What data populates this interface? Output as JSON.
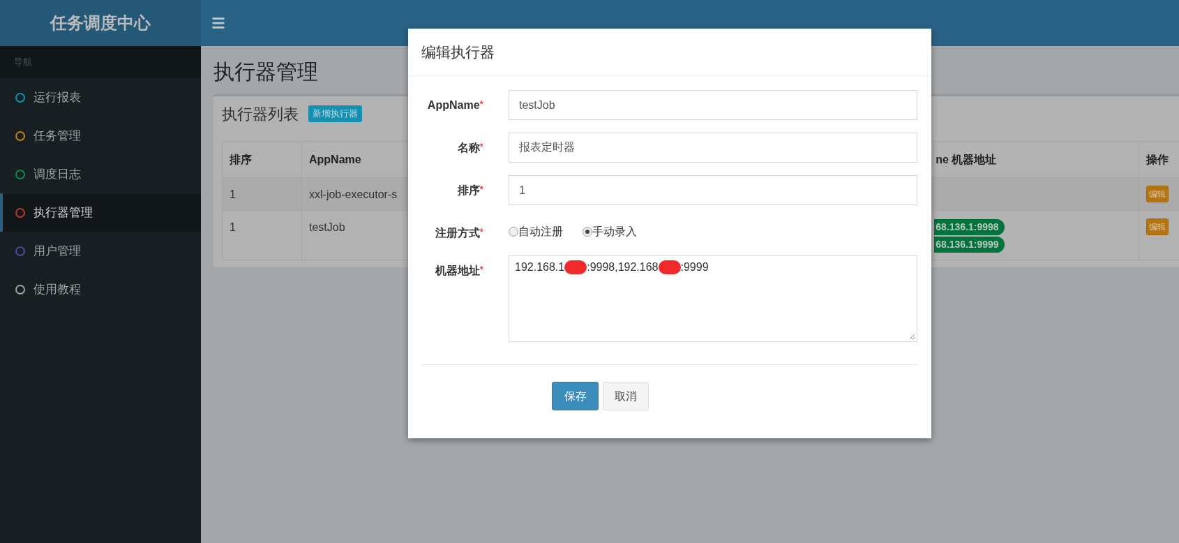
{
  "sidebar": {
    "brand": "任务调度中心",
    "section_header": "导航",
    "items": [
      {
        "label": "运行报表",
        "color": "#1490b0",
        "selected": false
      },
      {
        "label": "任务管理",
        "color": "#c47f1a",
        "selected": false
      },
      {
        "label": "调度日志",
        "color": "#0b8a48",
        "selected": false
      },
      {
        "label": "执行器管理",
        "color": "#b5392c",
        "selected": true
      },
      {
        "label": "用户管理",
        "color": "#4f4892",
        "selected": false
      },
      {
        "label": "使用教程",
        "color": "#a0a0a0",
        "selected": false
      }
    ]
  },
  "page": {
    "title": "执行器管理",
    "box": {
      "title": "执行器列表",
      "add_button": "新增执行器",
      "table": {
        "columns": [
          "排序",
          "AppName",
          "ne 机器地址",
          "操作"
        ],
        "rows": [
          {
            "order": "1",
            "app_name": "xxl-job-executor-s",
            "addresses": [],
            "action": "编辑"
          },
          {
            "order": "1",
            "app_name": "testJob",
            "addresses": [
              "68.136.1:9998",
              "68.136.1:9999"
            ],
            "action": "编辑"
          }
        ]
      }
    }
  },
  "modal": {
    "title": "编辑执行器",
    "fields": [
      {
        "kind": "input",
        "label": "AppName",
        "mark": "*",
        "value": "testJob"
      },
      {
        "kind": "input",
        "label": "名称",
        "mark": "*",
        "value": "报表定时器"
      },
      {
        "kind": "input",
        "label": "排序",
        "mark": "*",
        "value": "1"
      },
      {
        "kind": "radio",
        "label": "注册方式",
        "mark": "*",
        "options": [
          {
            "label": "自动注册",
            "selected": false
          },
          {
            "label": "手动录入",
            "selected": true
          }
        ]
      },
      {
        "kind": "textarea",
        "label": "机器地址",
        "mark": "*",
        "parts": [
          {
            "kind": "text",
            "text": "192.168.1"
          },
          {
            "kind": "redaction"
          },
          {
            "kind": "text",
            "text": ":9998,192.168"
          },
          {
            "kind": "redaction"
          },
          {
            "kind": "text",
            "text": ":9999"
          }
        ]
      }
    ],
    "buttons": [
      {
        "label": "保存",
        "kind": "primary"
      },
      {
        "label": "取消",
        "kind": "default"
      }
    ]
  }
}
